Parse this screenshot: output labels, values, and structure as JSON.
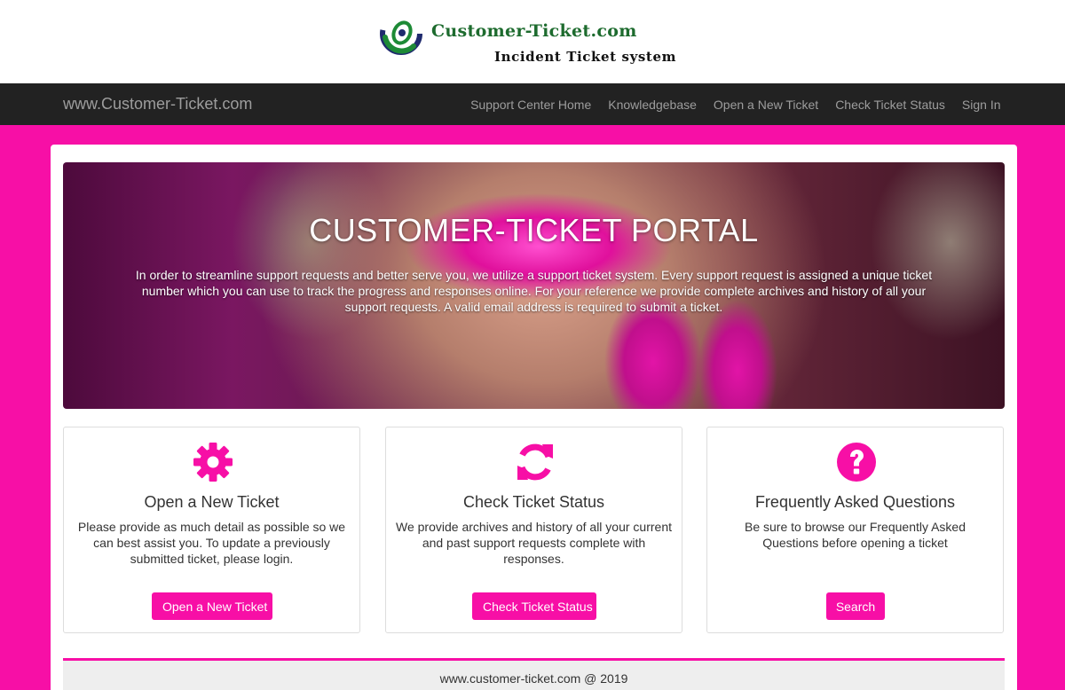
{
  "header": {
    "logo_title": "Customer-Ticket.com",
    "logo_subtitle": "Incident Ticket system",
    "logo_icon": "swirl-logo-icon"
  },
  "navbar": {
    "brand": "www.Customer-Ticket.com",
    "links": [
      {
        "label": "Support Center Home"
      },
      {
        "label": "Knowledgebase"
      },
      {
        "label": "Open a New Ticket"
      },
      {
        "label": "Check Ticket Status"
      },
      {
        "label": "Sign In"
      }
    ]
  },
  "hero": {
    "title": "CUSTOMER-TICKET PORTAL",
    "text": "In order to streamline support requests and better serve you, we utilize a support ticket system. Every support request is assigned a unique ticket number which you can use to track the progress and responses online. For your reference we provide complete archives and history of all your support requests. A valid email address is required to submit a ticket."
  },
  "panels": [
    {
      "icon": "gear-icon",
      "title": "Open a New Ticket",
      "text": "Please provide as much detail as possible so we can best assist you. To update a previously submitted ticket, please login.",
      "button": "Open a New Ticket"
    },
    {
      "icon": "refresh-icon",
      "title": "Check Ticket Status",
      "text": "We provide archives and history of all your current and past support requests complete with responses.",
      "button": "Check Ticket Status"
    },
    {
      "icon": "question-icon",
      "title": "Frequently Asked Questions",
      "text": "Be sure to browse our Frequently Asked Questions before opening a ticket",
      "button": "Search"
    }
  ],
  "footer": {
    "text": "www.customer-ticket.com @ 2019"
  },
  "colors": {
    "accent": "#f70fa6",
    "navbar": "#222222",
    "logo_green": "#1d6b2e",
    "logo_navy": "#1f2a6e"
  }
}
